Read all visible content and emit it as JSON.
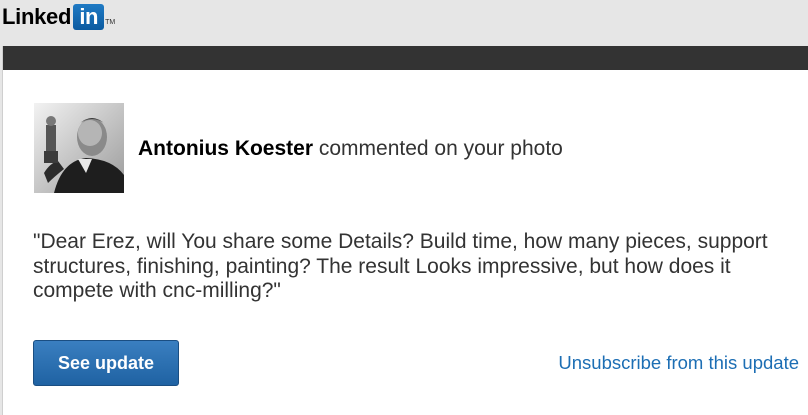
{
  "brand": {
    "logo_word": "Linked",
    "logo_badge": "in",
    "logo_tm": "TM",
    "badge_color": "#0b5aa0"
  },
  "notification": {
    "author_name": "Antonius Koester",
    "action_text": " commented on your photo",
    "comment": "\"Dear Erez, will You share some Details? Build time, how many pieces, support structures, finishing, painting? The result Looks impressive, but how does it compete with cnc-milling?\""
  },
  "actions": {
    "see_update_label": "See update",
    "unsubscribe_label": "Unsubscribe from this update"
  },
  "colors": {
    "header_bar": "#333333",
    "button_bg": "#2a6fb0",
    "link": "#1c6eb4"
  }
}
